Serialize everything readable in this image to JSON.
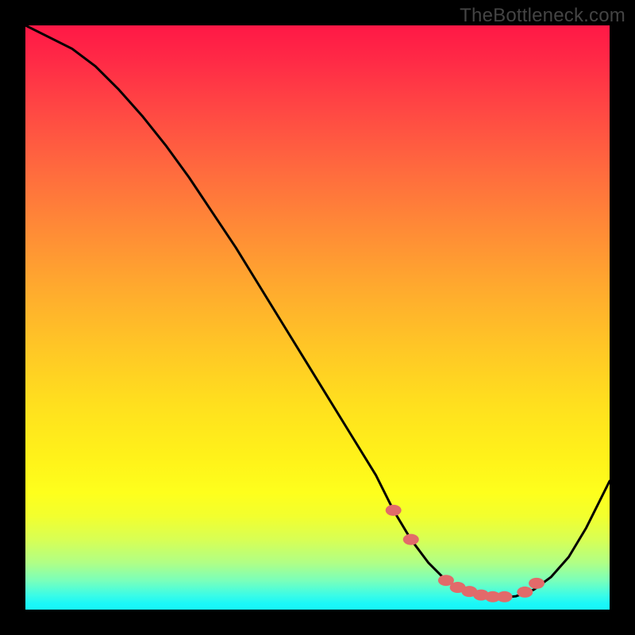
{
  "watermark": "TheBottleneck.com",
  "chart_data": {
    "type": "line",
    "title": "",
    "xlabel": "",
    "ylabel": "",
    "xlim": [
      0,
      100
    ],
    "ylim": [
      0,
      100
    ],
    "curve": {
      "x": [
        0,
        4,
        8,
        12,
        16,
        20,
        24,
        28,
        32,
        36,
        40,
        44,
        48,
        52,
        56,
        60,
        63,
        66,
        69,
        72,
        75,
        78,
        81,
        84,
        87,
        90,
        93,
        96,
        100
      ],
      "y": [
        100,
        98,
        96,
        93,
        89,
        84.5,
        79.5,
        74,
        68,
        62,
        55.5,
        49,
        42.5,
        36,
        29.5,
        23,
        17,
        12,
        8,
        5,
        3.2,
        2.3,
        2.0,
        2.3,
        3.4,
        5.6,
        9.0,
        14,
        22
      ]
    },
    "markers": {
      "x": [
        63,
        66,
        72,
        74,
        76,
        78,
        80,
        82,
        85.5,
        87.5
      ],
      "y": [
        17,
        12,
        5,
        3.8,
        3.1,
        2.5,
        2.2,
        2.2,
        3.0,
        4.5
      ]
    },
    "background_gradient": {
      "top": "#ff1846",
      "mid": "#ffe01e",
      "bottom": "#18f5f9"
    }
  }
}
